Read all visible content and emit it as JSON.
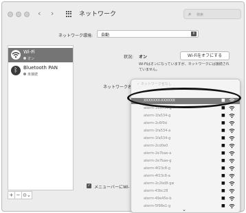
{
  "window": {
    "title": "ネットワーク"
  },
  "toolbar": {
    "back": "‹",
    "forward": "›",
    "search_placeholder": "検索"
  },
  "location": {
    "label": "ネットワーク環境:",
    "value": "自動"
  },
  "sidebar": {
    "items": [
      {
        "name": "Wi-Fi",
        "status": "オン",
        "icon": "wifi-icon"
      },
      {
        "name": "Bluetooth PAN",
        "status": "未接続",
        "icon": "bluetooth-icon"
      }
    ],
    "add": "+",
    "remove": "−",
    "action": "⊙⌄"
  },
  "status": {
    "label": "状況:",
    "value": "オン",
    "turn_off_button": "Wi-Fiをオフにする",
    "description": "Wi-Fiはオンになっていますが、ネットワークには接続されていません。"
  },
  "network_name": {
    "label": "ネットワーク名",
    "placeholder": "✓ ネットワーク名なし"
  },
  "menubar_checkbox": {
    "label": "メニューバーにWi-"
  },
  "network_list": [
    {
      "name": "XXXXXXX-XXXXXX",
      "locked": true,
      "selected": true
    },
    {
      "name": "aterm-31a534-g",
      "locked": true
    },
    {
      "name": "aterm-1fa534-g",
      "locked": true
    },
    {
      "name": "aterm-2c6f0d",
      "locked": true
    },
    {
      "name": "aterm-1fa534-a",
      "locked": true
    },
    {
      "name": "aterm-1fa534-g",
      "locked": true
    },
    {
      "name": "aterm-2cd0e0",
      "locked": true
    },
    {
      "name": "aterm-2e7bae-a",
      "locked": true
    },
    {
      "name": "aterm-2e7bae-g",
      "locked": true
    },
    {
      "name": "aterm-4f23c8-g",
      "locked": true
    },
    {
      "name": "aterm-4f23c8-a",
      "locked": true
    },
    {
      "name": "aterm-2c2bd8-gw",
      "locked": true
    },
    {
      "name": "aterm-43bc28",
      "locked": true
    },
    {
      "name": "aterm-49e45e-b",
      "locked": true
    },
    {
      "name": "aterm-5f98e1-g",
      "locked": true
    }
  ],
  "scroll_down": "⌄",
  "colors": {
    "selection": "#7a7a7a",
    "highlight_ring": "#111111"
  }
}
